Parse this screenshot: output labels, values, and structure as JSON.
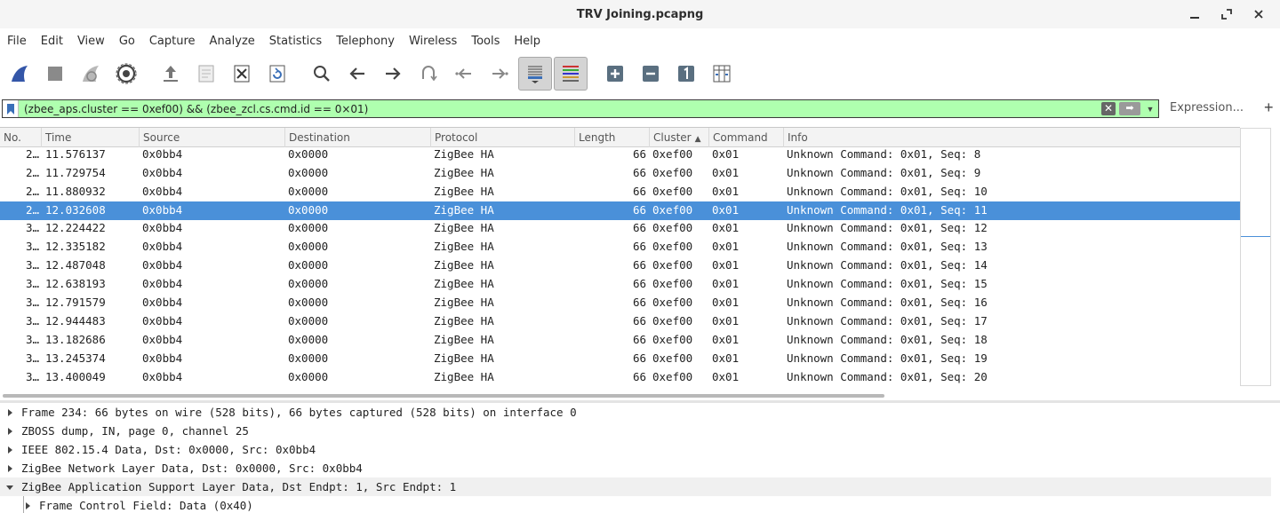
{
  "window": {
    "title": "TRV Joining.pcapng",
    "controls": [
      "minimize-icon",
      "maximize-icon",
      "close-icon"
    ]
  },
  "menu": [
    "File",
    "Edit",
    "View",
    "Go",
    "Capture",
    "Analyze",
    "Statistics",
    "Telephony",
    "Wireless",
    "Tools",
    "Help"
  ],
  "toolbar": {
    "buttons": [
      {
        "icon": "shark-fin-start-icon",
        "pressed": false
      },
      {
        "icon": "stop-capture-icon",
        "pressed": false
      },
      {
        "icon": "restart-capture-icon",
        "pressed": false
      },
      {
        "icon": "capture-options-gear-icon",
        "pressed": false
      },
      {
        "icon": "open-file-icon",
        "pressed": false
      },
      {
        "icon": "save-file-icon",
        "pressed": false
      },
      {
        "icon": "close-file-icon",
        "pressed": false
      },
      {
        "icon": "reload-file-icon",
        "pressed": false
      },
      {
        "icon": "find-packet-icon",
        "pressed": false
      },
      {
        "icon": "go-back-icon",
        "pressed": false
      },
      {
        "icon": "go-forward-icon",
        "pressed": false
      },
      {
        "icon": "go-to-packet-icon",
        "pressed": false
      },
      {
        "icon": "first-packet-icon",
        "pressed": false
      },
      {
        "icon": "last-packet-icon",
        "pressed": false
      },
      {
        "icon": "auto-scroll-icon",
        "pressed": true
      },
      {
        "icon": "colorize-icon",
        "pressed": true
      },
      {
        "icon": "zoom-in-icon",
        "pressed": false
      },
      {
        "icon": "zoom-out-icon",
        "pressed": false
      },
      {
        "icon": "normal-size-icon",
        "pressed": false
      },
      {
        "icon": "resize-columns-icon",
        "pressed": false
      }
    ]
  },
  "filter": {
    "value": "(zbee_aps.cluster == 0xef00) && (zbee_zcl.cs.cmd.id == 0×01)",
    "expression_label": "Expression...",
    "add_label": "+",
    "bg_color": "#afffaf"
  },
  "packet_list": {
    "columns": [
      {
        "key": "no",
        "label": "No."
      },
      {
        "key": "time",
        "label": "Time"
      },
      {
        "key": "source",
        "label": "Source"
      },
      {
        "key": "destination",
        "label": "Destination"
      },
      {
        "key": "protocol",
        "label": "Protocol"
      },
      {
        "key": "length",
        "label": "Length"
      },
      {
        "key": "cluster",
        "label": "Cluster",
        "sorted": "ascending"
      },
      {
        "key": "command",
        "label": "Command"
      },
      {
        "key": "info",
        "label": "Info"
      }
    ],
    "selected_color": "#4a90d9",
    "rows": [
      {
        "no": "2…",
        "time": "11.576137",
        "source": "0x0bb4",
        "destination": "0x0000",
        "protocol": "ZigBee HA",
        "length": "66",
        "cluster": "0xef00",
        "command": "0x01",
        "info": "Unknown Command: 0x01, Seq: 8",
        "selected": false
      },
      {
        "no": "2…",
        "time": "11.729754",
        "source": "0x0bb4",
        "destination": "0x0000",
        "protocol": "ZigBee HA",
        "length": "66",
        "cluster": "0xef00",
        "command": "0x01",
        "info": "Unknown Command: 0x01, Seq: 9",
        "selected": false
      },
      {
        "no": "2…",
        "time": "11.880932",
        "source": "0x0bb4",
        "destination": "0x0000",
        "protocol": "ZigBee HA",
        "length": "66",
        "cluster": "0xef00",
        "command": "0x01",
        "info": "Unknown Command: 0x01, Seq: 10",
        "selected": false
      },
      {
        "no": "2…",
        "time": "12.032608",
        "source": "0x0bb4",
        "destination": "0x0000",
        "protocol": "ZigBee HA",
        "length": "66",
        "cluster": "0xef00",
        "command": "0x01",
        "info": "Unknown Command: 0x01, Seq: 11",
        "selected": true
      },
      {
        "no": "3…",
        "time": "12.224422",
        "source": "0x0bb4",
        "destination": "0x0000",
        "protocol": "ZigBee HA",
        "length": "66",
        "cluster": "0xef00",
        "command": "0x01",
        "info": "Unknown Command: 0x01, Seq: 12",
        "selected": false
      },
      {
        "no": "3…",
        "time": "12.335182",
        "source": "0x0bb4",
        "destination": "0x0000",
        "protocol": "ZigBee HA",
        "length": "66",
        "cluster": "0xef00",
        "command": "0x01",
        "info": "Unknown Command: 0x01, Seq: 13",
        "selected": false
      },
      {
        "no": "3…",
        "time": "12.487048",
        "source": "0x0bb4",
        "destination": "0x0000",
        "protocol": "ZigBee HA",
        "length": "66",
        "cluster": "0xef00",
        "command": "0x01",
        "info": "Unknown Command: 0x01, Seq: 14",
        "selected": false
      },
      {
        "no": "3…",
        "time": "12.638193",
        "source": "0x0bb4",
        "destination": "0x0000",
        "protocol": "ZigBee HA",
        "length": "66",
        "cluster": "0xef00",
        "command": "0x01",
        "info": "Unknown Command: 0x01, Seq: 15",
        "selected": false
      },
      {
        "no": "3…",
        "time": "12.791579",
        "source": "0x0bb4",
        "destination": "0x0000",
        "protocol": "ZigBee HA",
        "length": "66",
        "cluster": "0xef00",
        "command": "0x01",
        "info": "Unknown Command: 0x01, Seq: 16",
        "selected": false
      },
      {
        "no": "3…",
        "time": "12.944483",
        "source": "0x0bb4",
        "destination": "0x0000",
        "protocol": "ZigBee HA",
        "length": "66",
        "cluster": "0xef00",
        "command": "0x01",
        "info": "Unknown Command: 0x01, Seq: 17",
        "selected": false
      },
      {
        "no": "3…",
        "time": "13.182686",
        "source": "0x0bb4",
        "destination": "0x0000",
        "protocol": "ZigBee HA",
        "length": "66",
        "cluster": "0xef00",
        "command": "0x01",
        "info": "Unknown Command: 0x01, Seq: 18",
        "selected": false
      },
      {
        "no": "3…",
        "time": "13.245374",
        "source": "0x0bb4",
        "destination": "0x0000",
        "protocol": "ZigBee HA",
        "length": "66",
        "cluster": "0xef00",
        "command": "0x01",
        "info": "Unknown Command: 0x01, Seq: 19",
        "selected": false
      },
      {
        "no": "3…",
        "time": "13.400049",
        "source": "0x0bb4",
        "destination": "0x0000",
        "protocol": "ZigBee HA",
        "length": "66",
        "cluster": "0xef00",
        "command": "0x01",
        "info": "Unknown Command: 0x01, Seq: 20",
        "selected": false
      }
    ]
  },
  "details": [
    {
      "text": "Frame 234: 66 bytes on wire (528 bits), 66 bytes captured (528 bits) on interface 0",
      "expanded": false,
      "level": 0
    },
    {
      "text": "ZBOSS dump, IN, page 0, channel 25",
      "expanded": false,
      "level": 0
    },
    {
      "text": "IEEE 802.15.4 Data, Dst: 0x0000, Src: 0x0bb4",
      "expanded": false,
      "level": 0
    },
    {
      "text": "ZigBee Network Layer Data, Dst: 0x0000, Src: 0x0bb4",
      "expanded": false,
      "level": 0
    },
    {
      "text": "ZigBee Application Support Layer Data, Dst Endpt: 1, Src Endpt: 1",
      "expanded": true,
      "level": 0
    },
    {
      "text": "Frame Control Field: Data (0x40)",
      "expanded": false,
      "level": 1
    }
  ]
}
